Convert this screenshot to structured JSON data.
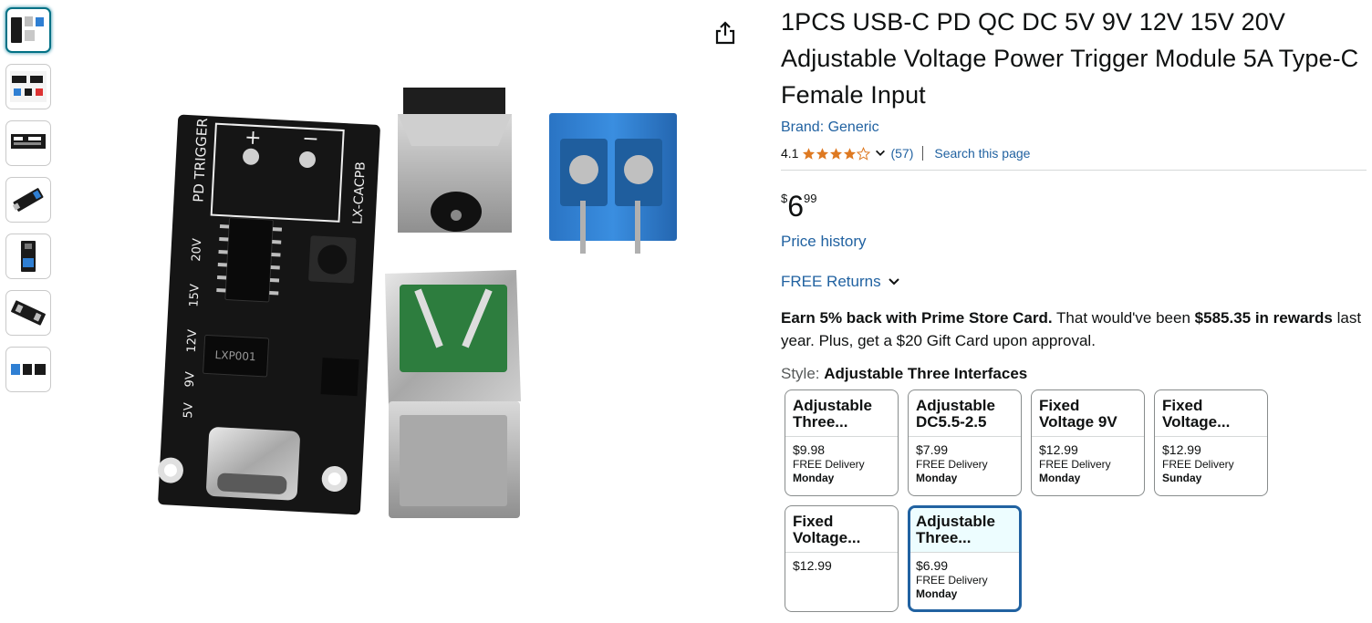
{
  "product": {
    "title": "1PCS USB-C PD QC DC 5V 9V 12V 15V 20V Adjustable Voltage Power Trigger Module 5A Type-C Female Input",
    "brand": "Brand: Generic",
    "rating_value": "4.1",
    "rating_fraction": 0.82,
    "rating_count": "(57)",
    "search_page": "Search this page"
  },
  "image_labels": {
    "pd_trigger": "PD TRIGGER",
    "board_id": "LX-CACPB",
    "v20": "20V",
    "v15": "15V",
    "v12": "12V",
    "v9": "9V",
    "v5": "5V",
    "chip": "LXP001",
    "plus": "+",
    "minus": "−"
  },
  "price": {
    "symbol": "$",
    "whole": "6",
    "fraction": "99",
    "history": "Price history",
    "returns": "FREE Returns"
  },
  "promo": {
    "bold1": "Earn 5% back with Prime Store Card.",
    "text1": " That would've been ",
    "bold2": "$585.35 in rewards",
    "text2": " last year. Plus, get a $20 Gift Card upon approval."
  },
  "style": {
    "label": "Style:",
    "value": "Adjustable Three Interfaces"
  },
  "swatches": [
    {
      "title": "Adjustable Three...",
      "price": "$9.98",
      "delivery": "FREE Delivery",
      "day": "Monday",
      "selected": false
    },
    {
      "title": "Adjustable DC5.5-2.5",
      "price": "$7.99",
      "delivery": "FREE Delivery",
      "day": "Monday",
      "selected": false
    },
    {
      "title": "Fixed Voltage 9V",
      "price": "$12.99",
      "delivery": "FREE Delivery",
      "day": "Monday",
      "selected": false
    },
    {
      "title": "Fixed Voltage...",
      "price": "$12.99",
      "delivery": "FREE Delivery",
      "day": "Sunday",
      "selected": false
    },
    {
      "title": "Fixed Voltage...",
      "price": "$12.99",
      "delivery": "",
      "day": "",
      "selected": false
    },
    {
      "title": "Adjustable Three...",
      "price": "$6.99",
      "delivery": "FREE Delivery",
      "day": "Monday",
      "selected": true
    }
  ],
  "icons": {
    "share": "share-icon",
    "star": "star-icon",
    "chevron": "chevron-down-icon"
  },
  "colors": {
    "link": "#2162a1",
    "star": "#de7921",
    "selected_border": "#2162a1",
    "pcb": "#1a1a1a",
    "terminal": "#2f7fd3"
  }
}
